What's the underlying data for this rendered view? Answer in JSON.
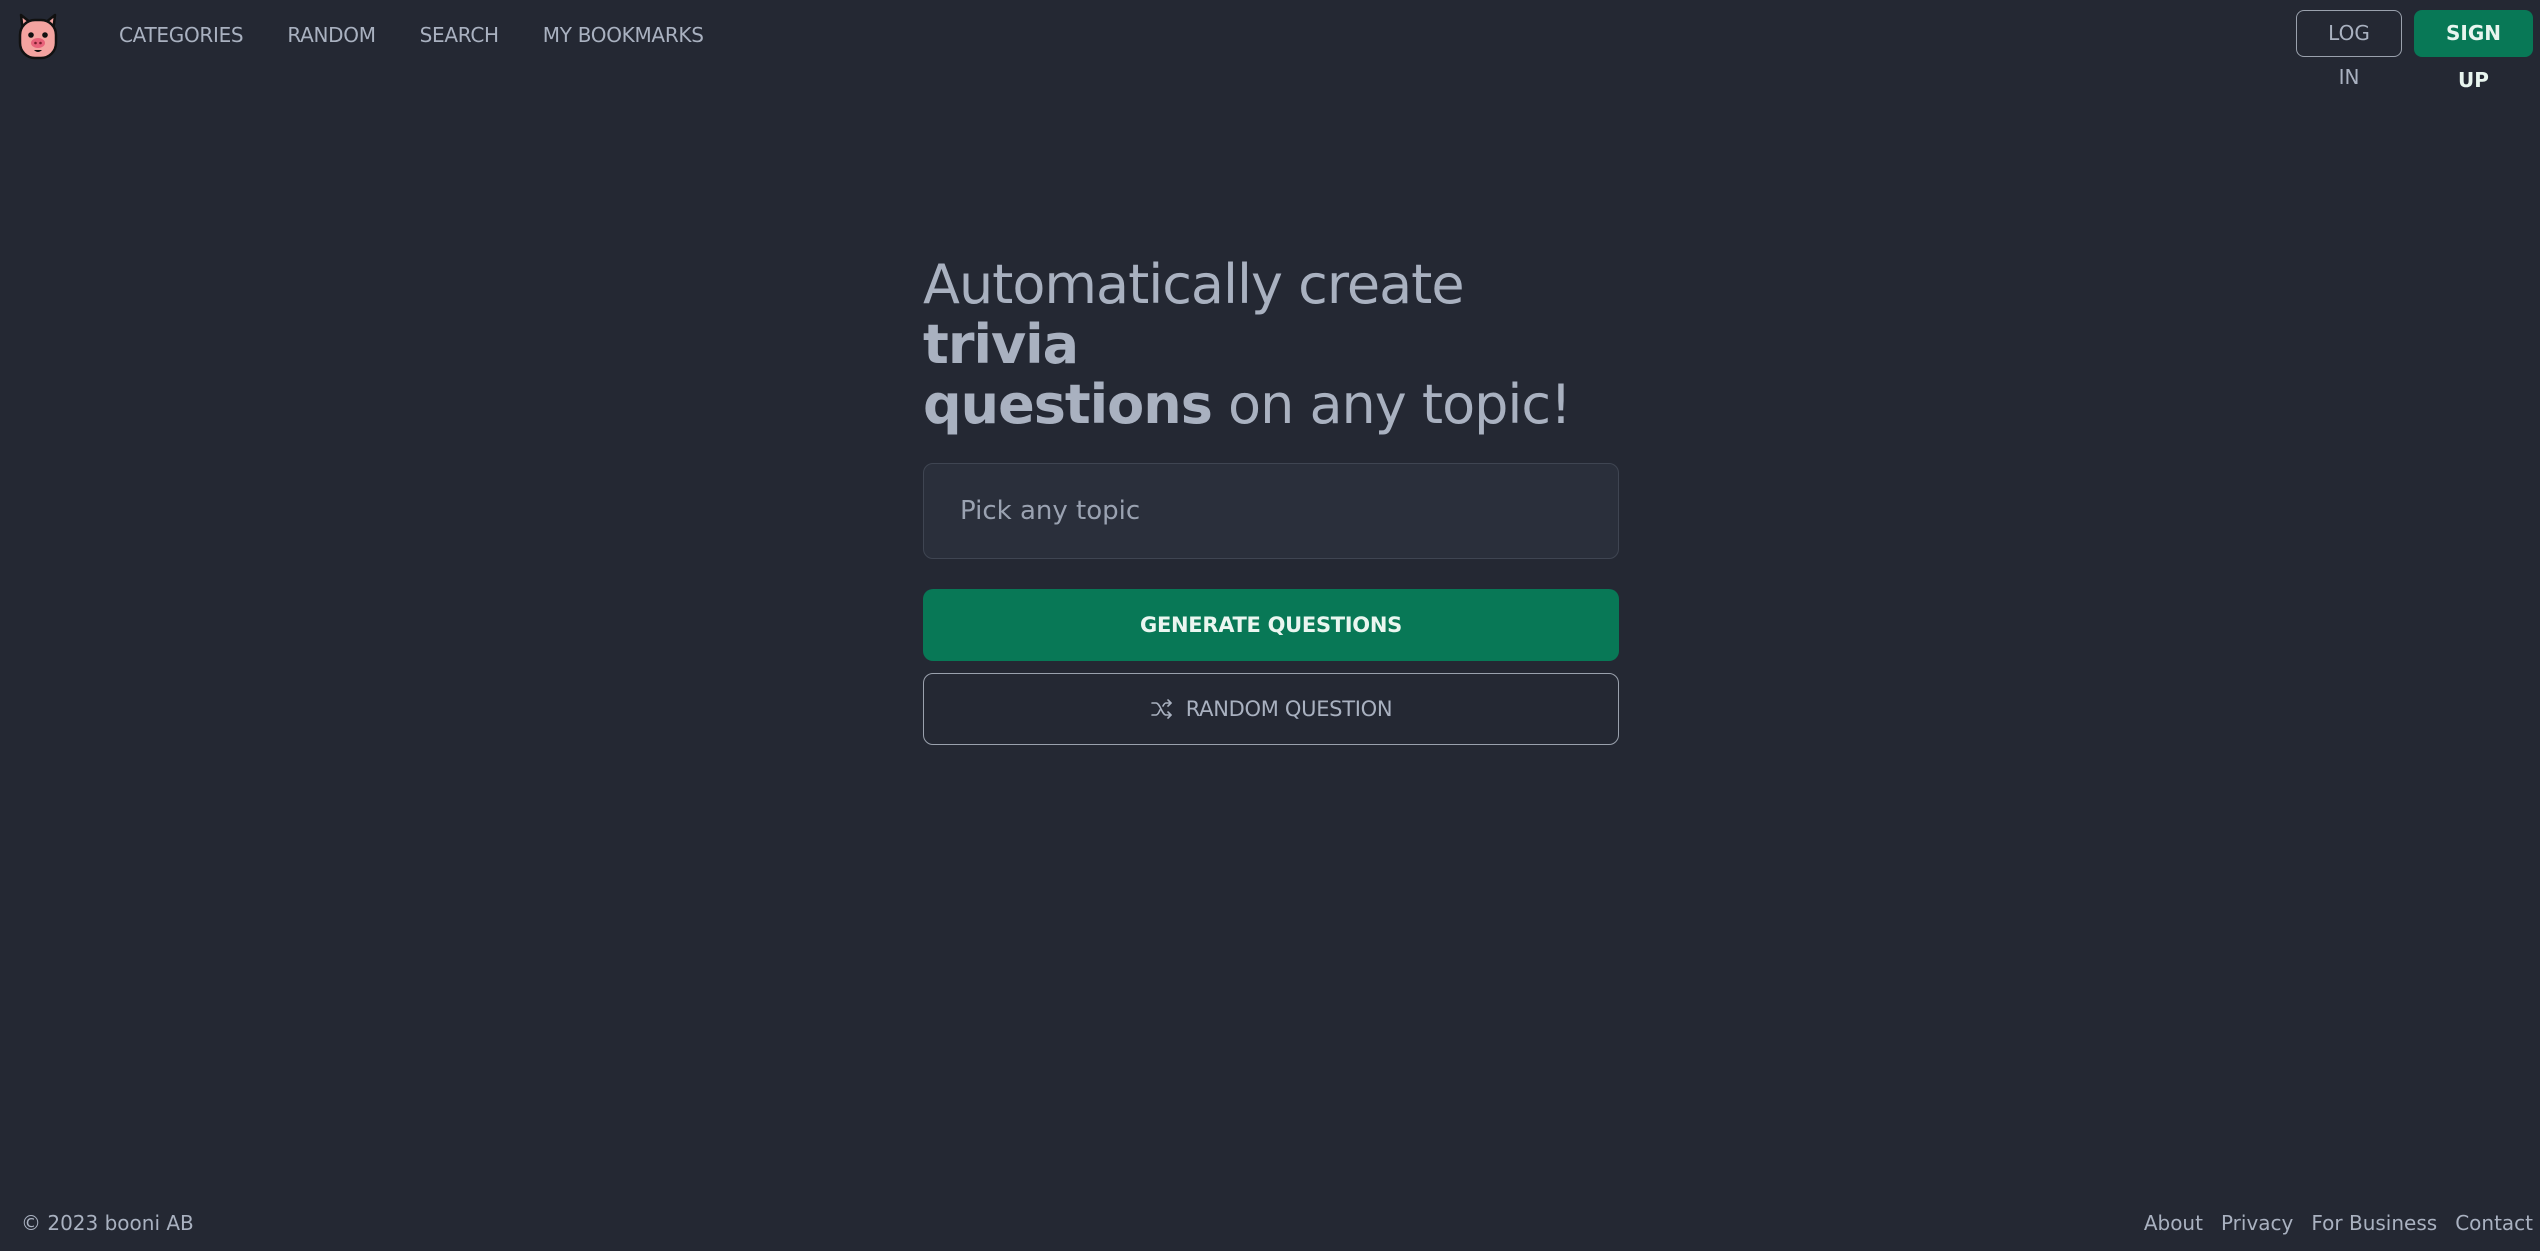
{
  "navbar": {
    "logo_icon": "pig-face-icon",
    "links": [
      {
        "label": "CATEGORIES"
      },
      {
        "label": "RANDOM"
      },
      {
        "label": "SEARCH"
      },
      {
        "label": "MY BOOKMARKS"
      }
    ],
    "login_label": "LOG IN",
    "signup_label": "SIGN UP"
  },
  "hero": {
    "headline_part1": "Automatically create ",
    "headline_bold1": "trivia",
    "headline_bold2": "questions",
    "headline_part2": " on any topic!"
  },
  "form": {
    "topic_placeholder": "Pick any topic",
    "topic_value": "",
    "generate_label": "GENERATE QUESTIONS",
    "random_label": "RANDOM QUESTION",
    "random_icon": "shuffle-icon"
  },
  "footer": {
    "copyright": "© 2023 booni AB",
    "links": [
      {
        "label": "About"
      },
      {
        "label": "Privacy"
      },
      {
        "label": "For Business"
      },
      {
        "label": "Contact"
      }
    ]
  },
  "colors": {
    "background": "#242833",
    "accent": "#087856",
    "text": "#a9b1c0"
  }
}
